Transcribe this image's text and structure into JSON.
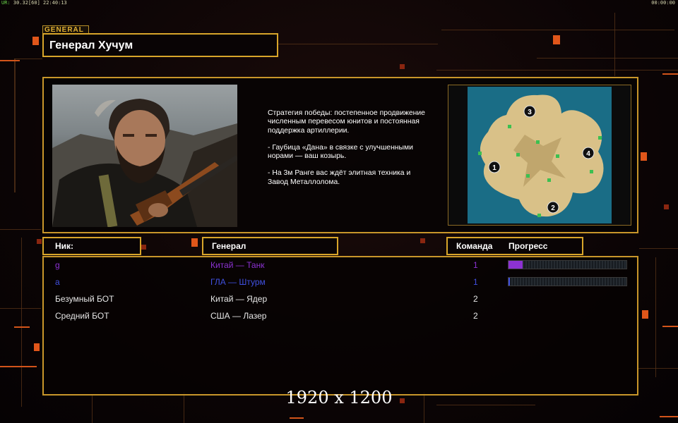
{
  "hud": {
    "fps_label": "UR:",
    "fps_value": "30.32",
    "fps_extra": "[60]",
    "clock": "22:40:13",
    "timer": "00:00:00"
  },
  "header": {
    "tag": "GENERAL",
    "title": "Генерал Хучум"
  },
  "briefing": {
    "paragraphs": [
      "Стратегия победы: постепенное продвижение численным перевесом юнитов и постоянная поддержка артиллерии.",
      "- Гаубица «Дана» в связке с улучшенными норами — ваш козырь.",
      "- На 3м Ранге вас ждёт элитная техника и Завод Металлолома."
    ],
    "map": {
      "start_positions": [
        "1",
        "2",
        "3",
        "4"
      ]
    }
  },
  "table": {
    "headers": {
      "nick": "Ник:",
      "general": "Генерал",
      "team": "Команда",
      "progress": "Прогресс"
    },
    "rows": [
      {
        "nick": "g",
        "general": "Китай — Танк",
        "team": "1",
        "color": "#8c32d2",
        "progress": 0.12
      },
      {
        "nick": "a",
        "general": "ГЛА — Штурм",
        "team": "1",
        "color": "#4050e0",
        "progress": 0.01
      },
      {
        "nick": "Безумный БОТ",
        "general": "Китай — Ядер",
        "team": "2",
        "color": "#e6e6e6",
        "progress": null
      },
      {
        "nick": "Средний БОТ",
        "general": "США — Лазер",
        "team": "2",
        "color": "#e6e6e6",
        "progress": null
      }
    ]
  },
  "watermark": "1920 x 1200",
  "colors": {
    "accent": "#d8a52a",
    "frame": "#c8962a",
    "background": "#0b0405"
  }
}
